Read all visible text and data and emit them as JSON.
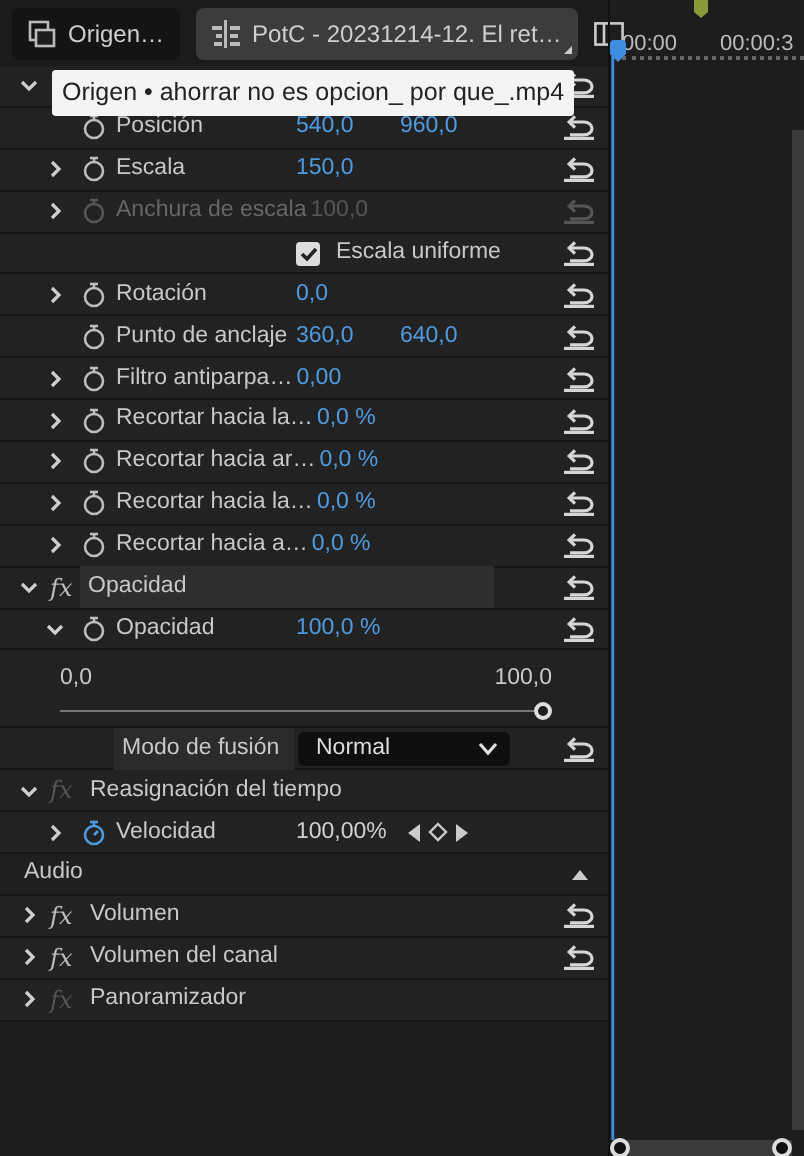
{
  "tabs": [
    {
      "label": "Origen…",
      "selected": false,
      "kind": "clip"
    },
    {
      "label": "PotC - 20231214-12. El ret…",
      "selected": true,
      "kind": "sequence"
    }
  ],
  "timeline": {
    "times": [
      "00:00",
      "00:00:3"
    ]
  },
  "tooltip": "Origen • ahorrar no es opcion_ por que_.mp4",
  "rows": [
    {
      "kind": "section",
      "expanded": true,
      "reset": true
    },
    {
      "kind": "param",
      "label": "Posición",
      "values": [
        "540,0",
        "960,0"
      ],
      "animated": false,
      "disabled": false,
      "reset": true
    },
    {
      "kind": "param",
      "label": "Escala",
      "expanded": false,
      "values": [
        "150,0"
      ],
      "animated": false,
      "disabled": false,
      "reset": true
    },
    {
      "kind": "param",
      "label": "Anchura de escala",
      "expanded": false,
      "values": [
        "100,0"
      ],
      "animated": false,
      "disabled": true,
      "reset": true
    },
    {
      "kind": "checkbox",
      "label": "Escala uniforme",
      "checked": true,
      "reset": true
    },
    {
      "kind": "param",
      "label": "Rotación",
      "expanded": false,
      "values": [
        "0,0"
      ],
      "animated": false,
      "disabled": false,
      "reset": true
    },
    {
      "kind": "param",
      "label": "Punto de anclaje",
      "values": [
        "360,0",
        "640,0"
      ],
      "animated": false,
      "disabled": false,
      "reset": true
    },
    {
      "kind": "param",
      "label": "Filtro antiparpa…",
      "expanded": false,
      "values": [
        "0,00"
      ],
      "animated": false,
      "disabled": false,
      "reset": true
    },
    {
      "kind": "param",
      "label": "Recortar hacia la…",
      "expanded": false,
      "values": [
        "0,0 %"
      ],
      "animated": false,
      "disabled": false,
      "reset": true
    },
    {
      "kind": "param",
      "label": "Recortar hacia ar…",
      "expanded": false,
      "values": [
        "0,0 %"
      ],
      "animated": false,
      "disabled": false,
      "reset": true
    },
    {
      "kind": "param",
      "label": "Recortar hacia la…",
      "expanded": false,
      "values": [
        "0,0 %"
      ],
      "animated": false,
      "disabled": false,
      "reset": true
    },
    {
      "kind": "param",
      "label": "Recortar hacia a…",
      "expanded": false,
      "values": [
        "0,0 %"
      ],
      "animated": false,
      "disabled": false,
      "reset": true
    },
    {
      "kind": "section",
      "icon": "fx",
      "label": "Opacidad",
      "expanded": true,
      "fx_active": true,
      "selected": true,
      "reset": true
    },
    {
      "kind": "param",
      "label": "Opacidad",
      "expanded": true,
      "values": [
        "100,0 %"
      ],
      "animated": false,
      "disabled": false,
      "reset": true
    },
    {
      "kind": "slider",
      "min_label": "0,0",
      "max_label": "100,0",
      "level": 1
    },
    {
      "kind": "dropdown",
      "label": "Modo de fusión",
      "value": "Normal",
      "reset": true
    },
    {
      "kind": "section",
      "icon": "fx",
      "label": "Reasignación del tiempo",
      "expanded": true,
      "fx_active": false,
      "selected": false,
      "reset": false
    },
    {
      "kind": "param",
      "label": "Velocidad",
      "expanded": false,
      "values": [
        "100,00%"
      ],
      "animated": true,
      "disabled": false,
      "reset": false
    },
    {
      "kind": "group",
      "label": "Audio",
      "expanded": true
    },
    {
      "kind": "section",
      "icon": "fx",
      "label": "Volumen",
      "expanded": false,
      "fx_active": true,
      "selected": false,
      "reset": true
    },
    {
      "kind": "section",
      "icon": "fx",
      "label": "Volumen del canal",
      "expanded": false,
      "fx_active": true,
      "selected": false,
      "reset": true
    },
    {
      "kind": "section",
      "icon": "fx",
      "label": "Panoramizador",
      "expanded": false,
      "fx_active": false,
      "selected": false,
      "reset": false
    }
  ]
}
